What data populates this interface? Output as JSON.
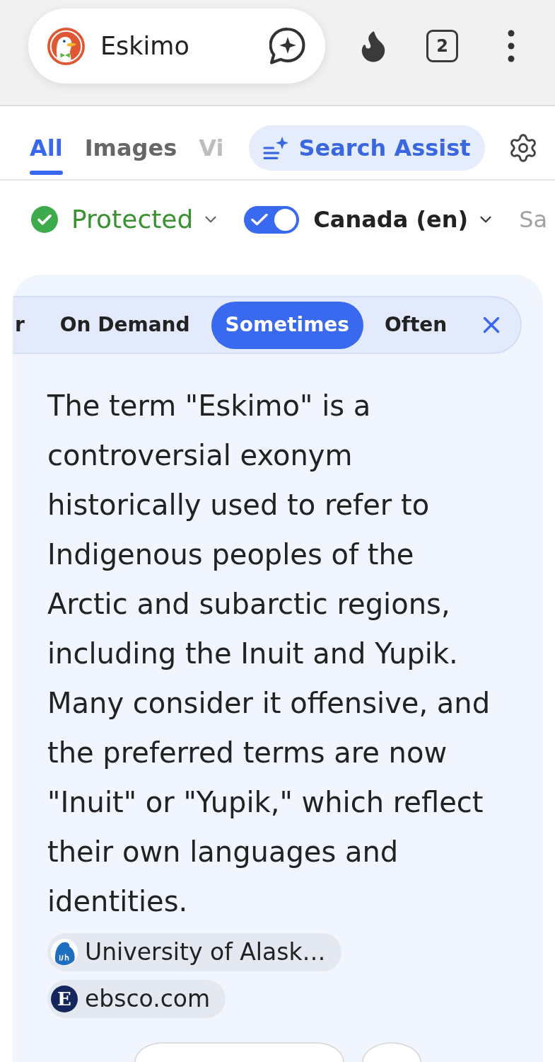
{
  "address_bar": {
    "query": "Eskimo",
    "tab_count": "2"
  },
  "tabs": [
    {
      "label": "All",
      "selected": true
    },
    {
      "label": "Images",
      "selected": false
    },
    {
      "label": "Vi",
      "selected": false
    }
  ],
  "search_assist": {
    "label": "Search Assist",
    "active": true
  },
  "filters": {
    "protection": {
      "label": "Protected"
    },
    "region": {
      "label": "Canada (en)",
      "on": true
    },
    "next_filter": {
      "label": "Sa"
    }
  },
  "assist_card": {
    "frequency_options": [
      {
        "label": "r",
        "selected": false
      },
      {
        "label": "On Demand",
        "selected": false
      },
      {
        "label": "Sometimes",
        "selected": true
      },
      {
        "label": "Often",
        "selected": false
      }
    ],
    "answer": "The term \"Eskimo\" is a controversial exonym historically used to refer to Indigenous peoples of the Arctic and subarctic regions, including the Inuit and Yupik. Many consider it offensive, and the preferred terms are now \"Inuit\" or \"Yupik,\" which reflect their own languages and identities.",
    "sources": [
      {
        "kind": "emblem",
        "label": "University of Alask…"
      },
      {
        "kind": "letter",
        "letter": "E",
        "label": "ebsco.com"
      }
    ]
  }
}
